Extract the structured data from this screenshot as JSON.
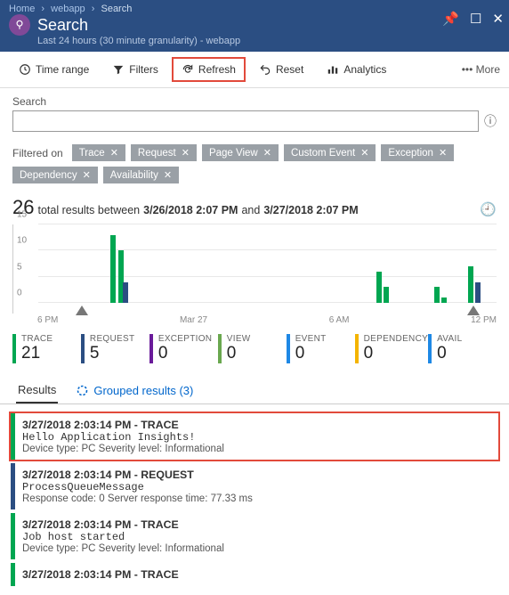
{
  "breadcrumb": {
    "home": "Home",
    "app": "webapp",
    "page": "Search"
  },
  "header": {
    "title": "Search",
    "subtitle": "Last 24 hours (30 minute granularity) - webapp"
  },
  "toolbar": {
    "time": "Time range",
    "filters": "Filters",
    "refresh": "Refresh",
    "reset": "Reset",
    "analytics": "Analytics",
    "more": "More"
  },
  "search": {
    "label": "Search",
    "value": ""
  },
  "filters": {
    "label": "Filtered on",
    "chips": [
      "Trace",
      "Request",
      "Page View",
      "Custom Event",
      "Exception",
      "Dependency",
      "Availability"
    ]
  },
  "summary": {
    "count": "26",
    "t1": "total results between",
    "from": "3/26/2018 2:07 PM",
    "t2": "and",
    "to": "3/27/2018 2:07 PM"
  },
  "chart_data": {
    "type": "bar",
    "ylim": [
      0,
      15
    ],
    "yticks": [
      0,
      5,
      10,
      15
    ],
    "xticks": [
      "6 PM",
      "Mar 27",
      "6 AM",
      "12 PM"
    ],
    "bars": [
      {
        "pos": 15,
        "h": 13,
        "color": "#00a651"
      },
      {
        "pos": 16.5,
        "h": 10,
        "color": "#00a651"
      },
      {
        "pos": 17.5,
        "h": 4,
        "color": "#2b4e82"
      },
      {
        "pos": 70,
        "h": 6,
        "color": "#00a651"
      },
      {
        "pos": 71.5,
        "h": 3,
        "color": "#00a651"
      },
      {
        "pos": 82,
        "h": 3,
        "color": "#00a651"
      },
      {
        "pos": 83.5,
        "h": 1,
        "color": "#00a651"
      },
      {
        "pos": 89,
        "h": 7,
        "color": "#00a651"
      },
      {
        "pos": 90.5,
        "h": 4,
        "color": "#2b4e82"
      }
    ],
    "markers": [
      9,
      90
    ]
  },
  "stats": [
    {
      "label": "TRACE",
      "value": "21",
      "color": "#00a651"
    },
    {
      "label": "REQUEST",
      "value": "5",
      "color": "#2b4e82"
    },
    {
      "label": "EXCEPTION",
      "value": "0",
      "color": "#6a1b9a"
    },
    {
      "label": "VIEW",
      "value": "0",
      "color": "#6aa84f"
    },
    {
      "label": "EVENT",
      "value": "0",
      "color": "#1e88e5"
    },
    {
      "label": "DEPENDENCY",
      "value": "0",
      "color": "#f4b400"
    },
    {
      "label": "AVAIL",
      "value": "0",
      "color": "#1e88e5"
    }
  ],
  "tabs": {
    "results": "Results",
    "grouped": "Grouped results (3)"
  },
  "items": [
    {
      "color": "#00a651",
      "highlight": true,
      "l1": "3/27/2018 2:03:14 PM - TRACE",
      "l2": "Hello Application Insights!",
      "l3": "Device type: PC Severity level: Informational"
    },
    {
      "color": "#2b4e82",
      "l1": "3/27/2018 2:03:14 PM - REQUEST",
      "l2": "ProcessQueueMessage",
      "l3": "Response code: 0 Server response time: 77.33 ms"
    },
    {
      "color": "#00a651",
      "l1": "3/27/2018 2:03:14 PM - TRACE",
      "l2": "Job host started",
      "l3": "Device type: PC Severity level: Informational"
    },
    {
      "color": "#00a651",
      "l1": "3/27/2018 2:03:14 PM - TRACE",
      "l2": "",
      "l3": ""
    }
  ]
}
